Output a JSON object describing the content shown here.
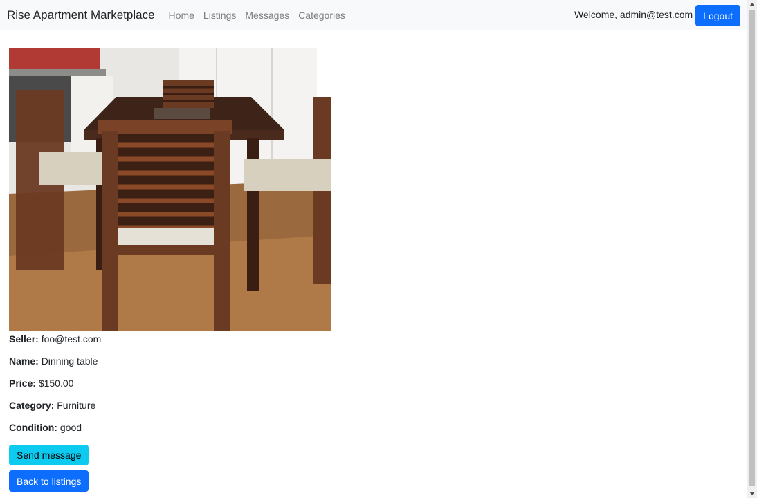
{
  "navbar": {
    "brand": "Rise Apartment Marketplace",
    "links": [
      "Home",
      "Listings",
      "Messages",
      "Categories"
    ],
    "welcome": "Welcome, admin@test.com",
    "logout_label": "Logout"
  },
  "listing": {
    "image_alt": "Dinning table with chairs",
    "fields": [
      {
        "label": "Seller:",
        "value": "foo@test.com"
      },
      {
        "label": "Name:",
        "value": "Dinning table"
      },
      {
        "label": "Price:",
        "value": "$150.00"
      },
      {
        "label": "Category:",
        "value": "Furniture"
      },
      {
        "label": "Condition:",
        "value": "good"
      }
    ]
  },
  "actions": {
    "send_message_label": "Send message",
    "back_label": "Back to listings"
  },
  "colors": {
    "primary": "#0d6efd",
    "info": "#0dcaf0",
    "navbar_bg": "#f8f9fa"
  }
}
